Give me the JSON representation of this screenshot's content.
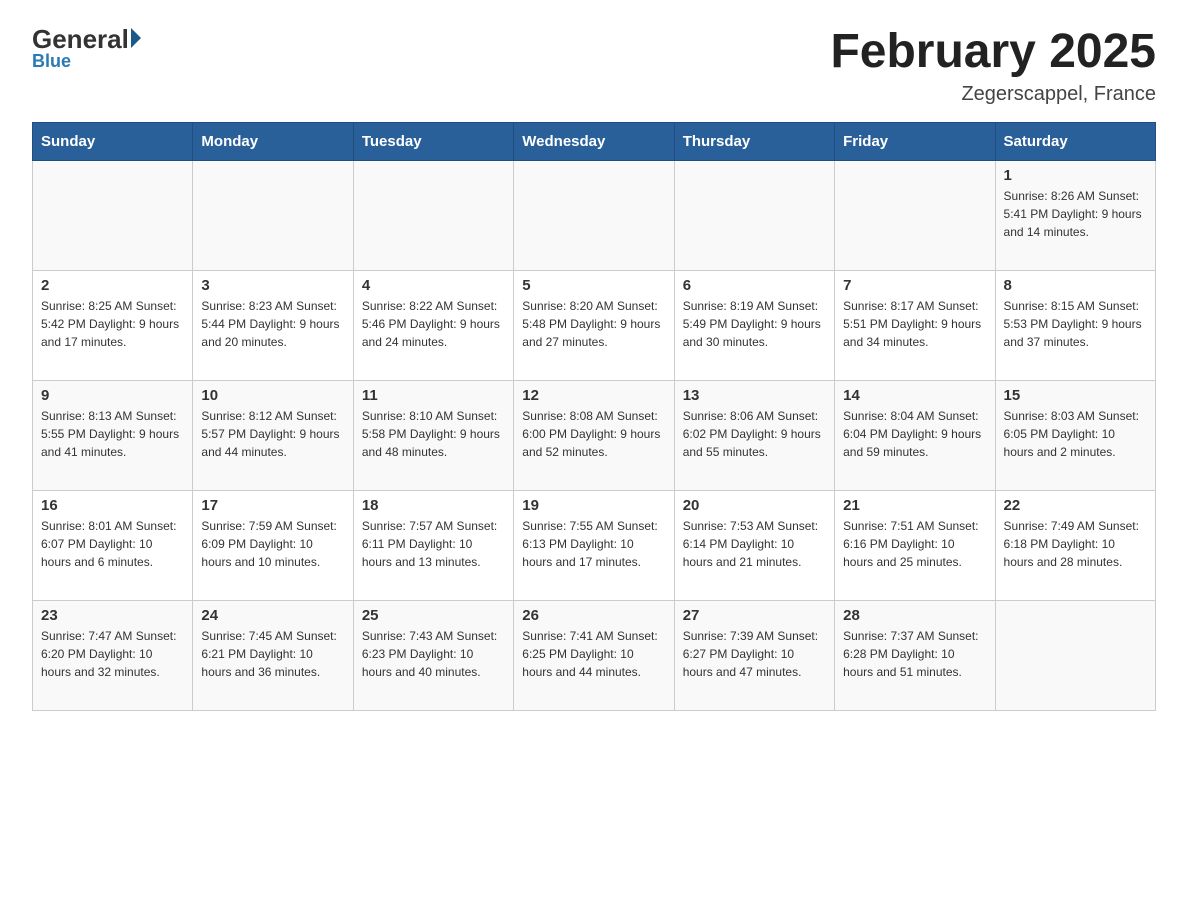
{
  "header": {
    "logo_general": "General",
    "logo_blue": "Blue",
    "title": "February 2025",
    "location": "Zegerscappel, France"
  },
  "days_of_week": [
    "Sunday",
    "Monday",
    "Tuesday",
    "Wednesday",
    "Thursday",
    "Friday",
    "Saturday"
  ],
  "weeks": [
    [
      {
        "num": "",
        "info": ""
      },
      {
        "num": "",
        "info": ""
      },
      {
        "num": "",
        "info": ""
      },
      {
        "num": "",
        "info": ""
      },
      {
        "num": "",
        "info": ""
      },
      {
        "num": "",
        "info": ""
      },
      {
        "num": "1",
        "info": "Sunrise: 8:26 AM\nSunset: 5:41 PM\nDaylight: 9 hours and 14 minutes."
      }
    ],
    [
      {
        "num": "2",
        "info": "Sunrise: 8:25 AM\nSunset: 5:42 PM\nDaylight: 9 hours and 17 minutes."
      },
      {
        "num": "3",
        "info": "Sunrise: 8:23 AM\nSunset: 5:44 PM\nDaylight: 9 hours and 20 minutes."
      },
      {
        "num": "4",
        "info": "Sunrise: 8:22 AM\nSunset: 5:46 PM\nDaylight: 9 hours and 24 minutes."
      },
      {
        "num": "5",
        "info": "Sunrise: 8:20 AM\nSunset: 5:48 PM\nDaylight: 9 hours and 27 minutes."
      },
      {
        "num": "6",
        "info": "Sunrise: 8:19 AM\nSunset: 5:49 PM\nDaylight: 9 hours and 30 minutes."
      },
      {
        "num": "7",
        "info": "Sunrise: 8:17 AM\nSunset: 5:51 PM\nDaylight: 9 hours and 34 minutes."
      },
      {
        "num": "8",
        "info": "Sunrise: 8:15 AM\nSunset: 5:53 PM\nDaylight: 9 hours and 37 minutes."
      }
    ],
    [
      {
        "num": "9",
        "info": "Sunrise: 8:13 AM\nSunset: 5:55 PM\nDaylight: 9 hours and 41 minutes."
      },
      {
        "num": "10",
        "info": "Sunrise: 8:12 AM\nSunset: 5:57 PM\nDaylight: 9 hours and 44 minutes."
      },
      {
        "num": "11",
        "info": "Sunrise: 8:10 AM\nSunset: 5:58 PM\nDaylight: 9 hours and 48 minutes."
      },
      {
        "num": "12",
        "info": "Sunrise: 8:08 AM\nSunset: 6:00 PM\nDaylight: 9 hours and 52 minutes."
      },
      {
        "num": "13",
        "info": "Sunrise: 8:06 AM\nSunset: 6:02 PM\nDaylight: 9 hours and 55 minutes."
      },
      {
        "num": "14",
        "info": "Sunrise: 8:04 AM\nSunset: 6:04 PM\nDaylight: 9 hours and 59 minutes."
      },
      {
        "num": "15",
        "info": "Sunrise: 8:03 AM\nSunset: 6:05 PM\nDaylight: 10 hours and 2 minutes."
      }
    ],
    [
      {
        "num": "16",
        "info": "Sunrise: 8:01 AM\nSunset: 6:07 PM\nDaylight: 10 hours and 6 minutes."
      },
      {
        "num": "17",
        "info": "Sunrise: 7:59 AM\nSunset: 6:09 PM\nDaylight: 10 hours and 10 minutes."
      },
      {
        "num": "18",
        "info": "Sunrise: 7:57 AM\nSunset: 6:11 PM\nDaylight: 10 hours and 13 minutes."
      },
      {
        "num": "19",
        "info": "Sunrise: 7:55 AM\nSunset: 6:13 PM\nDaylight: 10 hours and 17 minutes."
      },
      {
        "num": "20",
        "info": "Sunrise: 7:53 AM\nSunset: 6:14 PM\nDaylight: 10 hours and 21 minutes."
      },
      {
        "num": "21",
        "info": "Sunrise: 7:51 AM\nSunset: 6:16 PM\nDaylight: 10 hours and 25 minutes."
      },
      {
        "num": "22",
        "info": "Sunrise: 7:49 AM\nSunset: 6:18 PM\nDaylight: 10 hours and 28 minutes."
      }
    ],
    [
      {
        "num": "23",
        "info": "Sunrise: 7:47 AM\nSunset: 6:20 PM\nDaylight: 10 hours and 32 minutes."
      },
      {
        "num": "24",
        "info": "Sunrise: 7:45 AM\nSunset: 6:21 PM\nDaylight: 10 hours and 36 minutes."
      },
      {
        "num": "25",
        "info": "Sunrise: 7:43 AM\nSunset: 6:23 PM\nDaylight: 10 hours and 40 minutes."
      },
      {
        "num": "26",
        "info": "Sunrise: 7:41 AM\nSunset: 6:25 PM\nDaylight: 10 hours and 44 minutes."
      },
      {
        "num": "27",
        "info": "Sunrise: 7:39 AM\nSunset: 6:27 PM\nDaylight: 10 hours and 47 minutes."
      },
      {
        "num": "28",
        "info": "Sunrise: 7:37 AM\nSunset: 6:28 PM\nDaylight: 10 hours and 51 minutes."
      },
      {
        "num": "",
        "info": ""
      }
    ]
  ]
}
